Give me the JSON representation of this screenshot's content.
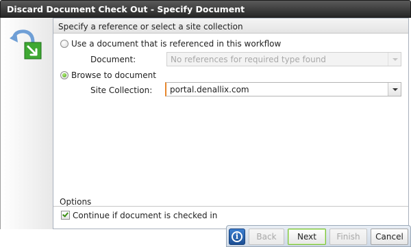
{
  "window": {
    "title": "Discard Document Check Out - Specify Document"
  },
  "sidebar": {
    "icon": "undo-checkout-icon"
  },
  "section": {
    "header": "Specify a reference or select a site collection"
  },
  "option_reference": {
    "label": "Use a document that is referenced in this workflow",
    "selected": false,
    "document_label": "Document:",
    "document_value": "No references for required type found"
  },
  "option_browse": {
    "label": "Browse to document",
    "selected": true,
    "site_collection_label": "Site Collection:",
    "site_collection_value": "portal.denallix.com"
  },
  "options": {
    "header": "Options",
    "continue_label": "Continue if document is checked in",
    "continue_checked": true
  },
  "buttons": {
    "info_icon": "info-icon",
    "back": "Back",
    "next": "Next",
    "finish": "Finish",
    "cancel": "Cancel"
  },
  "colors": {
    "accent_green": "#3e9a10",
    "focus_orange": "#e8862a"
  }
}
